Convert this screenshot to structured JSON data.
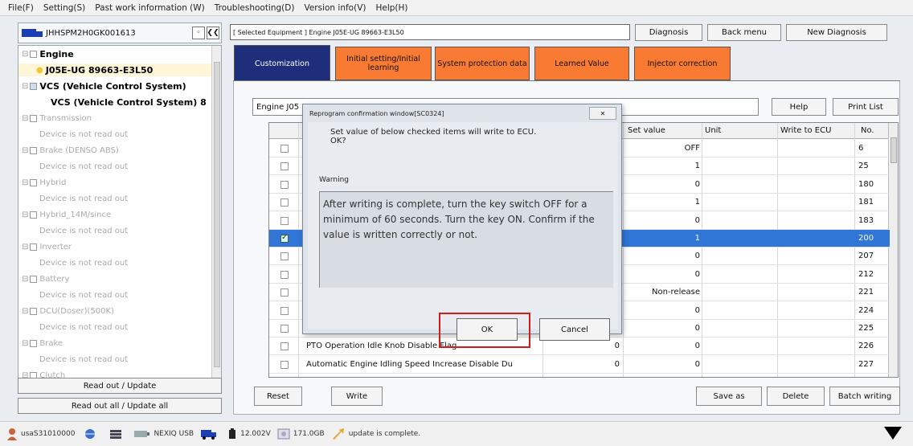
{
  "menu": [
    "File(F)",
    "Setting(S)",
    "Past work information (W)",
    "Troubleshooting(D)",
    "Version info(V)",
    "Help(H)"
  ],
  "left": {
    "vin": "JHHSPM2H0GK001613",
    "small_btn": "◦",
    "collapse_btn": "❮❮",
    "tree": [
      {
        "label": "Engine",
        "style": "b",
        "indent": 4,
        "expander": "⊟",
        "box": true
      },
      {
        "label": "J05E-UG 89663-E3L50",
        "style": "b",
        "indent": 22,
        "bulb": true,
        "selected": true
      },
      {
        "label": "VCS (Vehicle Control System)",
        "style": "b",
        "indent": 4,
        "expander": "⊟",
        "box": true,
        "checked": true
      },
      {
        "label": "VCS (Vehicle Control System) 8",
        "style": "b",
        "indent": 40
      },
      {
        "label": "Transmission",
        "style": "g",
        "indent": 4,
        "expander": "⊟",
        "box": true
      },
      {
        "label": "Device is not read out",
        "style": "g",
        "indent": 26
      },
      {
        "label": "Brake (DENSO ABS)",
        "style": "g",
        "indent": 4,
        "expander": "⊟",
        "box": true
      },
      {
        "label": "Device is not read out",
        "style": "g",
        "indent": 26
      },
      {
        "label": "Hybrid",
        "style": "g",
        "indent": 4,
        "expander": "⊟",
        "box": true
      },
      {
        "label": "Device is not read out",
        "style": "g",
        "indent": 26
      },
      {
        "label": "Hybrid_14M/since",
        "style": "g",
        "indent": 4,
        "expander": "⊟",
        "box": true
      },
      {
        "label": "Device is not read out",
        "style": "g",
        "indent": 26
      },
      {
        "label": "Inverter",
        "style": "g",
        "indent": 4,
        "expander": "⊟",
        "box": true
      },
      {
        "label": "Device is not read out",
        "style": "g",
        "indent": 26
      },
      {
        "label": "Battery",
        "style": "g",
        "indent": 4,
        "expander": "⊟",
        "box": true
      },
      {
        "label": "Device is not read out",
        "style": "g",
        "indent": 26
      },
      {
        "label": "DCU(Doser)(500K)",
        "style": "g",
        "indent": 4,
        "expander": "⊟",
        "box": true
      },
      {
        "label": "Device is not read out",
        "style": "g",
        "indent": 26
      },
      {
        "label": "Brake",
        "style": "g",
        "indent": 4,
        "expander": "⊟",
        "box": true
      },
      {
        "label": "Device is not read out",
        "style": "g",
        "indent": 26
      },
      {
        "label": "Clutch",
        "style": "g",
        "indent": 4,
        "expander": "⊟",
        "box": true
      }
    ],
    "read_out_update": "Read out / Update",
    "read_out_all": "Read out all / Update all"
  },
  "top": {
    "selected_equipment": "[ Selected Equipment ] Engine J05E-UG 89663-E3L50",
    "diagnosis": "Diagnosis",
    "back_menu": "Back menu",
    "new_diagnosis": "New Diagnosis"
  },
  "tabs": [
    {
      "label": "Customization",
      "active": true
    },
    {
      "label": "Initial setting/Initial learning",
      "active": false
    },
    {
      "label": "System protection data",
      "active": false
    },
    {
      "label": "Learned Value",
      "active": false
    },
    {
      "label": "Injector correction",
      "active": false
    }
  ],
  "filter_text": "Engine J05",
  "help": "Help",
  "print_list": "Print List",
  "grid": {
    "headers": {
      "set_value": "Set value",
      "unit": "Unit",
      "write_to_ecu": "Write to ECU",
      "no": "No."
    },
    "rows": [
      {
        "name": "",
        "current": "",
        "set": "OFF",
        "no": "6",
        "checked": false,
        "selected": false
      },
      {
        "name": "",
        "current": "",
        "set": "1",
        "no": "25",
        "checked": false,
        "selected": false
      },
      {
        "name": "",
        "current": "",
        "set": "0",
        "no": "180",
        "checked": false,
        "selected": false
      },
      {
        "name": "",
        "current": "",
        "set": "1",
        "no": "181",
        "checked": false,
        "selected": false
      },
      {
        "name": "",
        "current": "",
        "set": "0",
        "no": "183",
        "checked": false,
        "selected": false
      },
      {
        "name": "",
        "current": "",
        "set": "1",
        "no": "200",
        "checked": true,
        "selected": true
      },
      {
        "name": "",
        "current": "",
        "set": "0",
        "no": "207",
        "checked": false,
        "selected": false
      },
      {
        "name": "",
        "current": "",
        "set": "0",
        "no": "212",
        "checked": false,
        "selected": false
      },
      {
        "name": "",
        "current": "",
        "set": "Non-release",
        "no": "221",
        "checked": false,
        "selected": false
      },
      {
        "name": "",
        "current": "",
        "set": "0",
        "no": "224",
        "checked": false,
        "selected": false
      },
      {
        "name": "",
        "current": "",
        "set": "0",
        "no": "225",
        "checked": false,
        "selected": false
      },
      {
        "name": "PTO Operation Idle Knob Disable Flag",
        "current": "0",
        "set": "0",
        "no": "226",
        "checked": false,
        "selected": false
      },
      {
        "name": "Automatic Engine Idling Speed Increase Disable Du",
        "current": "0",
        "set": "0",
        "no": "227",
        "checked": false,
        "selected": false
      }
    ]
  },
  "bottom": {
    "reset": "Reset",
    "write": "Write",
    "save_as": "Save as",
    "delete": "Delete",
    "batch_writing": "Batch writing"
  },
  "dialog": {
    "title": "Reprogram confirmation window[SC0324]",
    "close": "✕",
    "message_line1": "Set value of below checked items will write to ECU.",
    "message_line2": "OK?",
    "warning_label": "Warning",
    "warning_text": "After writing is complete, turn the key switch OFF for a minimum of 60 seconds.  Turn the key ON. Confirm if the value is written correctly or not.",
    "ok": "OK",
    "cancel": "Cancel"
  },
  "status": {
    "user": "usaS31010000",
    "device": "NEXIQ USB",
    "voltage": "12.002V",
    "disk": "171.0GB",
    "message": "update is complete."
  },
  "colors": {
    "active_tab": "#1f2e7a",
    "orange_tab": "#f97a32",
    "selected_row": "#2f76d6",
    "ok_highlight": "#d21c1c"
  }
}
